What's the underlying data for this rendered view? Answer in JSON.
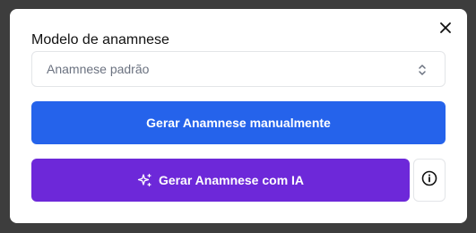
{
  "dialog": {
    "close_icon": "x-icon",
    "field_label": "Modelo de anamnese",
    "select": {
      "selected_value": "Anamnese padrão",
      "icon": "chevron-up-down-icon"
    },
    "manual_button_label": "Gerar Anamnese manualmente",
    "ai_button_label": "Gerar Anamnese com IA",
    "ai_button_icon": "sparkles-icon",
    "info_button_icon": "info-icon"
  },
  "colors": {
    "backdrop": "#3d3d3d",
    "primary_blue": "#2563eb",
    "ai_purple": "#6d28d9",
    "border": "#e3e5e8"
  }
}
